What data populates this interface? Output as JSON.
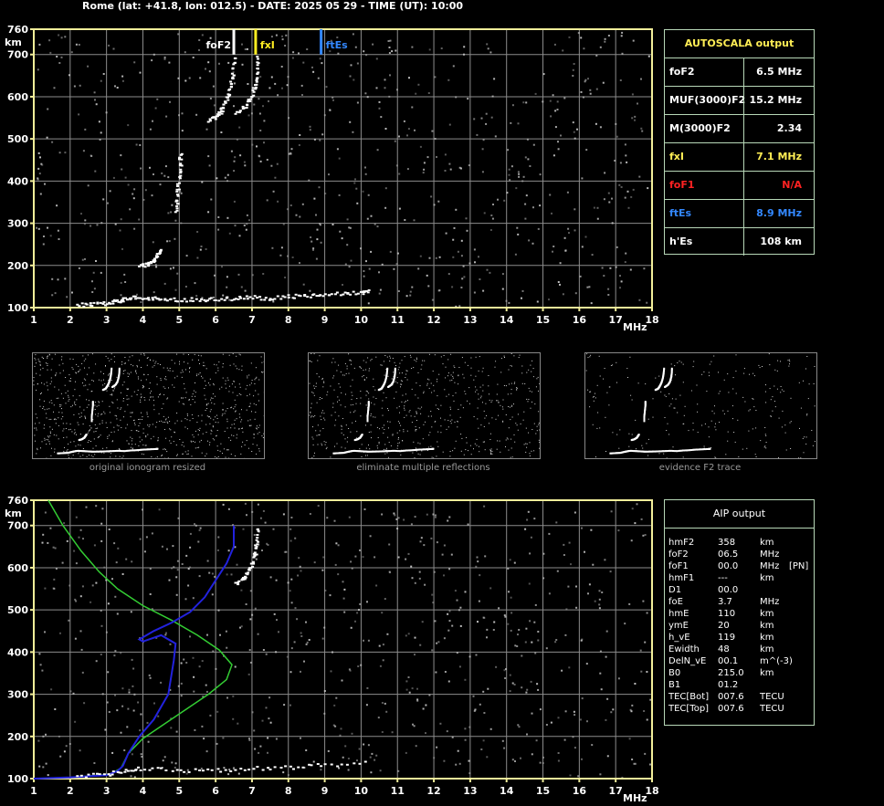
{
  "header": "Rome (lat: +41.8, lon: 012.5) - DATE: 2025 05 29 - TIME (UT): 10:00",
  "colors": {
    "plot_border": "#f2ee9a",
    "grid": "#8c8c8c",
    "noise": "#bdbdbd",
    "trace": "#ffffff",
    "fof2": "#ffffff",
    "fxi": "#ffee22",
    "ftes": "#3388ff",
    "fof1": "#ff2222",
    "profile_top": "#33cc33",
    "profile_bottom": "#2222dd"
  },
  "autoscala": {
    "title": "AUTOSCALA output",
    "rows": [
      {
        "label": "foF2",
        "value": "6.5 MHz",
        "color": "#ffffff"
      },
      {
        "label": "MUF(3000)F2",
        "value": "15.2 MHz",
        "color": "#ffffff"
      },
      {
        "label": "M(3000)F2",
        "value": "2.34",
        "color": "#ffffff"
      },
      {
        "label": "fxI",
        "value": "7.1 MHz",
        "color": "#ffee55"
      },
      {
        "label": "foF1",
        "value": "N/A",
        "color": "#ff2222"
      },
      {
        "label": "ftEs",
        "value": "8.9 MHz",
        "color": "#3388ff"
      },
      {
        "label": "h'Es",
        "value": "108    km",
        "color": "#ffffff"
      }
    ]
  },
  "aip": {
    "title": "AIP output",
    "rows": [
      [
        "hmF2",
        "358",
        "km",
        ""
      ],
      [
        "foF2",
        "06.5",
        "MHz",
        ""
      ],
      [
        "foF1",
        "00.0",
        "MHz",
        "[PN]"
      ],
      [
        "hmF1",
        "---",
        "km",
        ""
      ],
      [
        "D1",
        "00.0",
        "",
        ""
      ],
      [
        "foE",
        "3.7",
        "MHz",
        ""
      ],
      [
        "hmE",
        "110",
        "km",
        ""
      ],
      [
        "ymE",
        "20",
        "km",
        ""
      ],
      [
        "h_vE",
        "119",
        "km",
        ""
      ],
      [
        "Ewidth",
        "48",
        "km",
        ""
      ],
      [
        "DelN_vE",
        "00.1",
        "m^(-3)",
        ""
      ],
      [
        "B0",
        "215.0",
        "km",
        ""
      ],
      [
        "B1",
        "01.2",
        "",
        ""
      ],
      [
        "TEC[Bot]",
        "007.6",
        "TECU",
        ""
      ],
      [
        "TEC[Top]",
        "007.6",
        "TECU",
        ""
      ]
    ]
  },
  "thumbnails": [
    {
      "caption": "original ionogram resized"
    },
    {
      "caption": "eliminate multiple reflections"
    },
    {
      "caption": "evidence F2 trace"
    }
  ],
  "chart_data": [
    {
      "type": "scatter",
      "title": "",
      "xlabel": "MHz",
      "ylabel": "km",
      "xlim": [
        1,
        18
      ],
      "ylim": [
        100,
        760
      ],
      "xticks": [
        "1",
        "2",
        "3",
        "4",
        "5",
        "6",
        "7",
        "8",
        "9",
        "10",
        "11",
        "12",
        "13",
        "14",
        "15",
        "16",
        "17",
        "18"
      ],
      "yticks": [
        "100",
        "200",
        "300",
        "400",
        "500",
        "600",
        "700",
        "760"
      ],
      "markers": [
        {
          "name": "foF2",
          "x": 6.5
        },
        {
          "name": "fxI",
          "x": 7.1
        },
        {
          "name": "ftEs",
          "x": 8.9
        }
      ],
      "series": [
        {
          "points": [
            [
              2.2,
              108
            ],
            [
              2.6,
              110
            ],
            [
              3.0,
              112
            ],
            [
              3.3,
              118
            ],
            [
              3.5,
              122
            ],
            [
              3.8,
              126
            ],
            [
              4.2,
              124
            ],
            [
              4.6,
              122
            ],
            [
              5.0,
              120
            ],
            [
              5.5,
              121
            ],
            [
              6.0,
              122
            ],
            [
              6.5,
              124
            ],
            [
              7.0,
              126
            ],
            [
              7.5,
              124
            ],
            [
              8.0,
              128
            ],
            [
              8.5,
              130
            ],
            [
              9.0,
              134
            ],
            [
              9.5,
              136
            ],
            [
              10.0,
              138
            ],
            [
              10.2,
              140
            ]
          ]
        },
        {
          "points": [
            [
              3.9,
              200
            ],
            [
              4.1,
              205
            ],
            [
              4.3,
              215
            ],
            [
              4.4,
              228
            ],
            [
              4.5,
              240
            ]
          ]
        },
        {
          "points": [
            [
              4.9,
              330
            ],
            [
              4.9,
              360
            ],
            [
              4.95,
              400
            ],
            [
              5.0,
              440
            ],
            [
              5.0,
              470
            ]
          ]
        },
        {
          "points": [
            [
              5.8,
              545
            ],
            [
              6.0,
              553
            ],
            [
              6.1,
              565
            ],
            [
              6.2,
              580
            ],
            [
              6.3,
              600
            ],
            [
              6.4,
              630
            ],
            [
              6.45,
              660
            ],
            [
              6.5,
              700
            ]
          ]
        },
        {
          "points": [
            [
              6.55,
              565
            ],
            [
              6.8,
              580
            ],
            [
              6.95,
              600
            ],
            [
              7.05,
              630
            ],
            [
              7.1,
              660
            ],
            [
              7.12,
              700
            ]
          ]
        }
      ]
    },
    {
      "type": "line",
      "title": "",
      "xlabel": "MHz",
      "ylabel": "km",
      "xlim": [
        1,
        18
      ],
      "ylim": [
        100,
        760
      ],
      "xticks": [
        "1",
        "2",
        "3",
        "4",
        "5",
        "6",
        "7",
        "8",
        "9",
        "10",
        "11",
        "12",
        "13",
        "14",
        "15",
        "16",
        "17",
        "18"
      ],
      "yticks": [
        "100",
        "200",
        "300",
        "400",
        "500",
        "600",
        "700",
        "760"
      ],
      "series": [
        {
          "points": [
            [
              1.4,
              760
            ],
            [
              1.8,
              700
            ],
            [
              2.3,
              640
            ],
            [
              2.8,
              590
            ],
            [
              3.3,
              550
            ],
            [
              4.0,
              510
            ],
            [
              4.8,
              475
            ],
            [
              5.5,
              440
            ],
            [
              6.1,
              405
            ],
            [
              6.45,
              370
            ],
            [
              6.3,
              335
            ],
            [
              5.8,
              300
            ],
            [
              5.2,
              265
            ],
            [
              4.6,
              230
            ],
            [
              4.0,
              195
            ],
            [
              3.6,
              160
            ],
            [
              3.4,
              125
            ],
            [
              3.1,
              110
            ],
            [
              2.0,
              103
            ],
            [
              1.0,
              100
            ]
          ]
        },
        {
          "points": [
            [
              1.0,
              100
            ],
            [
              2.0,
              103
            ],
            [
              3.0,
              108
            ],
            [
              3.3,
              118
            ],
            [
              3.45,
              130
            ],
            [
              3.6,
              160
            ],
            [
              3.9,
              200
            ],
            [
              4.3,
              240
            ],
            [
              4.7,
              300
            ],
            [
              4.85,
              380
            ],
            [
              4.9,
              420
            ],
            [
              4.5,
              440
            ],
            [
              4.0,
              425
            ],
            [
              3.9,
              430
            ],
            [
              4.3,
              450
            ],
            [
              4.8,
              470
            ],
            [
              5.3,
              495
            ],
            [
              5.7,
              530
            ],
            [
              6.0,
              570
            ],
            [
              6.3,
              610
            ],
            [
              6.5,
              650
            ],
            [
              6.5,
              700
            ]
          ]
        },
        {
          "points": [
            [
              6.55,
              565
            ],
            [
              6.8,
              580
            ],
            [
              6.95,
              600
            ],
            [
              7.05,
              630
            ],
            [
              7.1,
              660
            ],
            [
              7.12,
              700
            ]
          ]
        },
        {
          "points": [
            [
              2.2,
              108
            ],
            [
              3.0,
              112
            ],
            [
              3.5,
              122
            ],
            [
              4.0,
              126
            ],
            [
              5.0,
              120
            ],
            [
              6.0,
              122
            ],
            [
              7.0,
              126
            ],
            [
              8.0,
              128
            ],
            [
              9.0,
              134
            ],
            [
              10.2,
              140
            ]
          ]
        }
      ]
    }
  ]
}
